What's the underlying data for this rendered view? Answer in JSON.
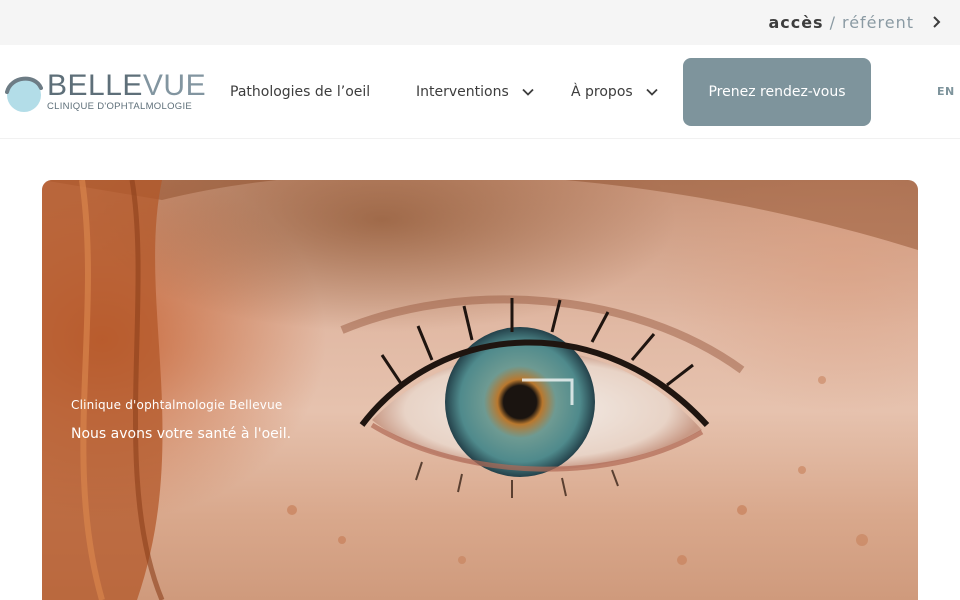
{
  "topbar": {
    "link_bold": "accès",
    "link_slash": "/",
    "link_rest": "référent"
  },
  "logo": {
    "name_dark": "BELLE",
    "name_light": "VUE",
    "subtitle": "CLINIQUE D'OPHTALMOLOGIE"
  },
  "nav": {
    "items": [
      {
        "label": "Pathologies de l’oeil",
        "has_dropdown": false
      },
      {
        "label": "Interventions",
        "has_dropdown": true
      },
      {
        "label": "À propos",
        "has_dropdown": true
      }
    ],
    "cta_label": "Prenez rendez-vous",
    "language": "EN"
  },
  "hero": {
    "kicker": "Clinique d'ophtalmologie Bellevue",
    "title": "Nous avons votre santé à l'oeil."
  },
  "colors": {
    "accent": "#7e949c",
    "logo_light": "#8295a0",
    "topbar_bg": "#f5f5f5"
  }
}
